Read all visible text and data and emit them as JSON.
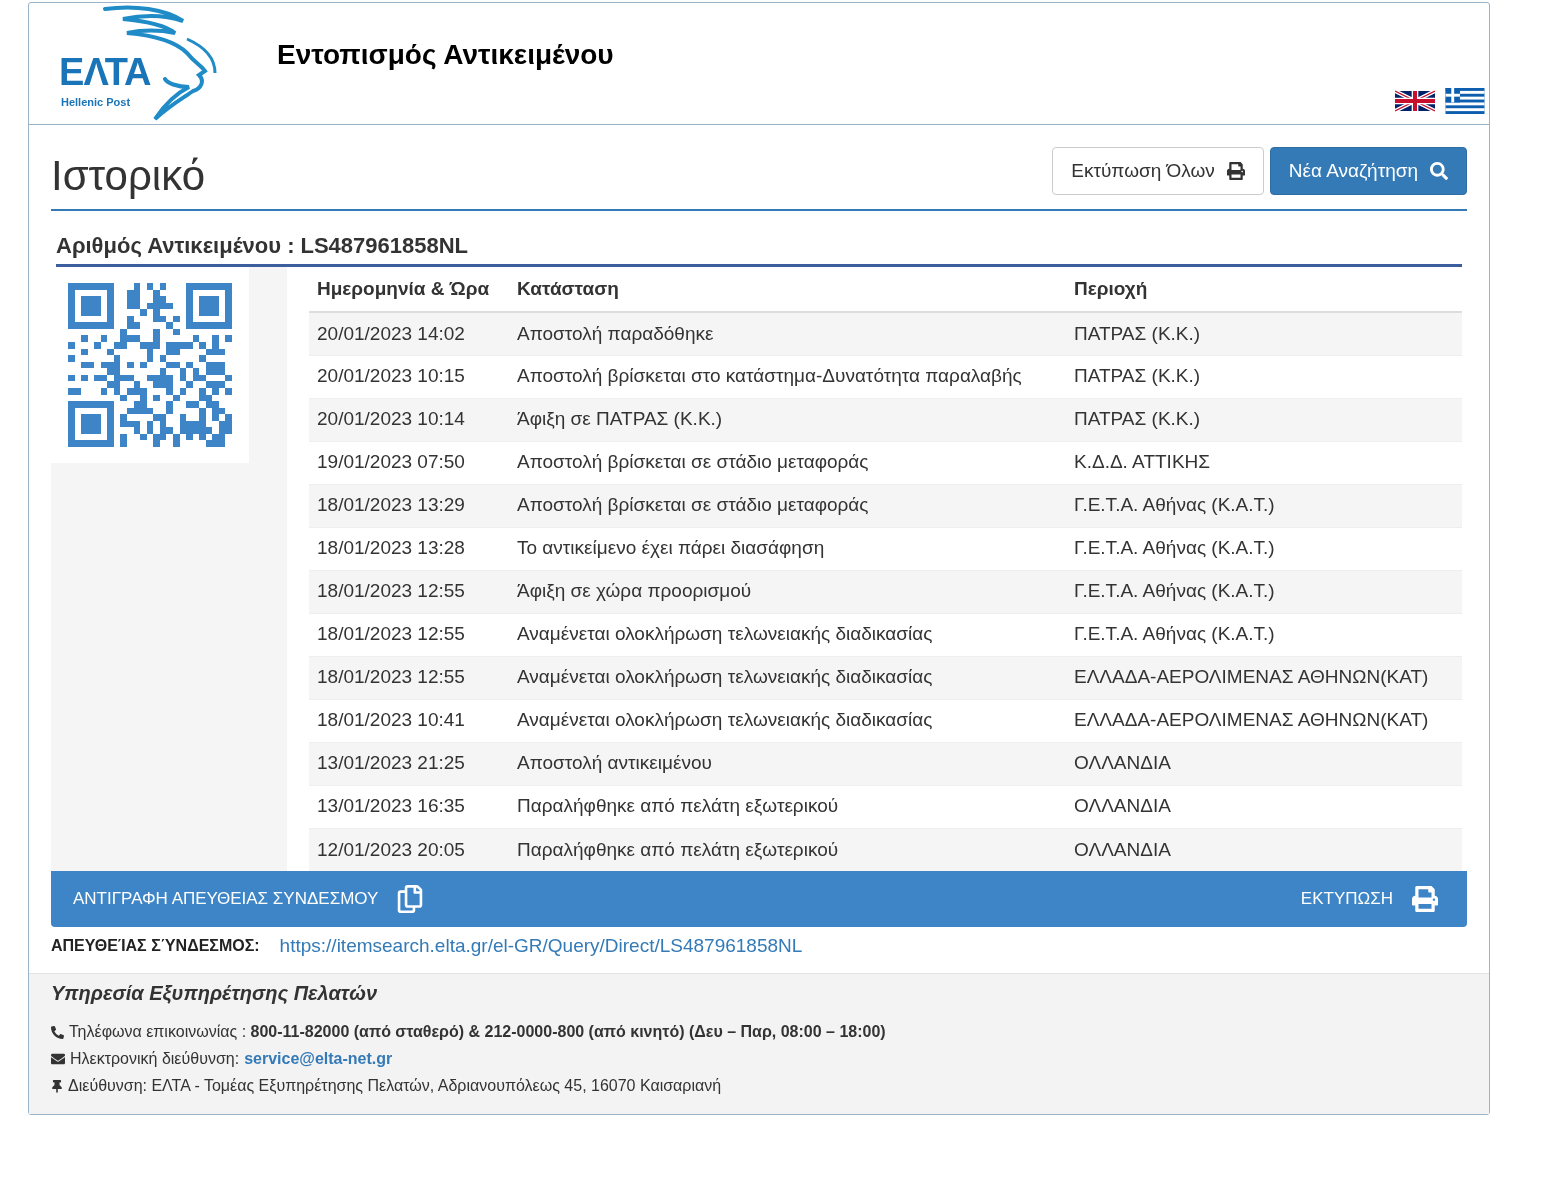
{
  "header": {
    "logo": {
      "name": "ΕΛΤΑ",
      "tagline": "Hellenic Post"
    },
    "title": "Εντοπισμός Αντικειμένου",
    "languages": [
      {
        "kind": "uk"
      },
      {
        "kind": "gr"
      }
    ]
  },
  "page": {
    "title": "Ιστορικό",
    "buttons": [
      {
        "kind": "print",
        "label": "Εκτύπωση Όλων"
      },
      {
        "kind": "search",
        "label": "Νέα Αναζήτηση"
      }
    ]
  },
  "item": {
    "label": "Αριθμός Αντικειμένου :",
    "number": "LS487961858NL"
  },
  "table": {
    "columns": [
      "Ημερομηνία & Ώρα",
      "Κατάσταση",
      "Περιοχή"
    ],
    "rows": [
      [
        "20/01/2023 14:02",
        "Αποστολή παραδόθηκε",
        "ΠΑΤΡΑΣ (Κ.Κ.)"
      ],
      [
        "20/01/2023 10:15",
        "Αποστολή βρίσκεται στο κατάστημα-Δυνατότητα παραλαβής",
        "ΠΑΤΡΑΣ (Κ.Κ.)"
      ],
      [
        "20/01/2023 10:14",
        "Άφιξη σε ΠΑΤΡΑΣ (Κ.Κ.)",
        "ΠΑΤΡΑΣ (Κ.Κ.)"
      ],
      [
        "19/01/2023 07:50",
        "Αποστολή βρίσκεται σε στάδιο μεταφοράς",
        "Κ.Δ.Δ. ΑΤΤΙΚΗΣ"
      ],
      [
        "18/01/2023 13:29",
        "Αποστολή βρίσκεται σε στάδιο μεταφοράς",
        "Γ.Ε.Τ.Α. Αθήνας (Κ.Α.Τ.)"
      ],
      [
        "18/01/2023 13:28",
        "Το αντικείμενο έχει πάρει διασάφηση",
        "Γ.Ε.Τ.Α. Αθήνας (Κ.Α.Τ.)"
      ],
      [
        "18/01/2023 12:55",
        "Άφιξη σε χώρα προορισμού",
        "Γ.Ε.Τ.Α. Αθήνας (Κ.Α.Τ.)"
      ],
      [
        "18/01/2023 12:55",
        "Αναμένεται ολοκλήρωση τελωνειακής διαδικασίας",
        "Γ.Ε.Τ.Α. Αθήνας (Κ.Α.Τ.)"
      ],
      [
        "18/01/2023 12:55",
        "Αναμένεται ολοκλήρωση τελωνειακής διαδικασίας",
        "ΕΛΛΑΔΑ-ΑΕΡΟΛΙΜΕΝΑΣ ΑΘΗΝΩΝ(ΚΑΤ)"
      ],
      [
        "18/01/2023 10:41",
        "Αναμένεται ολοκλήρωση τελωνειακής διαδικασίας",
        "ΕΛΛΑΔΑ-ΑΕΡΟΛΙΜΕΝΑΣ ΑΘΗΝΩΝ(ΚΑΤ)"
      ],
      [
        "13/01/2023 21:25",
        "Αποστολή αντικειμένου",
        "ΟΛΛΑΝΔΙΑ"
      ],
      [
        "13/01/2023 16:35",
        "Παραλήφθηκε από πελάτη εξωτερικού",
        "ΟΛΛΑΝΔΙΑ"
      ],
      [
        "12/01/2023 20:05",
        "Παραλήφθηκε από πελάτη εξωτερικού",
        "ΟΛΛΑΝΔΙΑ"
      ]
    ]
  },
  "action_bar": {
    "copy_label": "ΑΝΤΙΓΡΑΦΗ ΑΠΕΥΘΕΙΑΣ ΣΥΝΔΕΣΜΟΥ",
    "print_label": "ΕΚΤΥΠΩΣΗ"
  },
  "direct_link": {
    "label": "ΑΠΕΥΘΕΊΑΣ ΣΎΝΔΕΣΜΟΣ:",
    "url": "https://itemsearch.elta.gr/el-GR/Query/Direct/LS487961858NL"
  },
  "footer": {
    "title": "Υπηρεσία Εξυπηρέτησης Πελατών",
    "lines": [
      {
        "kind": "phone",
        "text": "Τηλέφωνα επικοινωνίας : **800-11-82000 (από σταθερό) & 212-0000-800 (από κινητό) (Δευ – Παρ, 08:00 – 18:00)**"
      },
      {
        "kind": "email",
        "text": "Ηλεκτρονική διεύθυνση:",
        "link": "service@elta-net.gr"
      },
      {
        "kind": "address",
        "text": "Διεύθυνση: ΕΛΤΑ - Τομέας Εξυπηρέτησης Πελατών, Αδριανουπόλεως 45, 16070 Καισαριανή"
      }
    ]
  }
}
